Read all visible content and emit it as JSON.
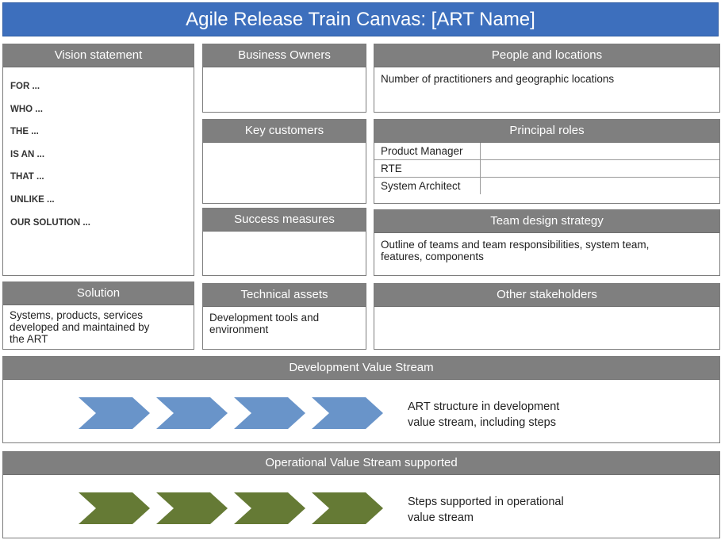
{
  "title": "Agile Release Train Canvas: [ART Name]",
  "colors": {
    "banner": "#3d6fbd",
    "section_header": "#7f7f7f",
    "development_chevron": "#6994c9",
    "operational_chevron": "#657a35"
  },
  "vision": {
    "title": "Vision statement",
    "items": [
      "FOR ...",
      "WHO ...",
      "THE ...",
      "IS AN ...",
      "THAT ...",
      "UNLIKE ...",
      "OUR SOLUTION ..."
    ]
  },
  "business_owners": {
    "title": "Business Owners",
    "text": ""
  },
  "key_customers": {
    "title": "Key customers",
    "text": ""
  },
  "success_measures": {
    "title": "Success measures",
    "text": ""
  },
  "people_locations": {
    "title": "People and locations",
    "text": "Number of practitioners and geographic locations"
  },
  "principal_roles": {
    "title": "Principal roles",
    "rows": [
      {
        "role": "Product Manager",
        "value": ""
      },
      {
        "role": "RTE",
        "value": ""
      },
      {
        "role": "System Architect",
        "value": ""
      }
    ]
  },
  "team_design": {
    "title": "Team design strategy",
    "text": "Outline of teams and team responsibilities, system team, features, components"
  },
  "solution": {
    "title": "Solution",
    "text": "Systems, products, services developed and maintained by the ART"
  },
  "technical_assets": {
    "title": "Technical assets",
    "text": "Development tools and environment"
  },
  "other_stakeholders": {
    "title": "Other stakeholders",
    "text": ""
  },
  "development_stream": {
    "title": "Development Value Stream",
    "steps": 4,
    "line1": "ART structure in development",
    "line2": "value stream, including steps"
  },
  "operational_stream": {
    "title": "Operational Value Stream supported",
    "steps": 4,
    "line1": "Steps supported in operational",
    "line2": "value stream"
  }
}
